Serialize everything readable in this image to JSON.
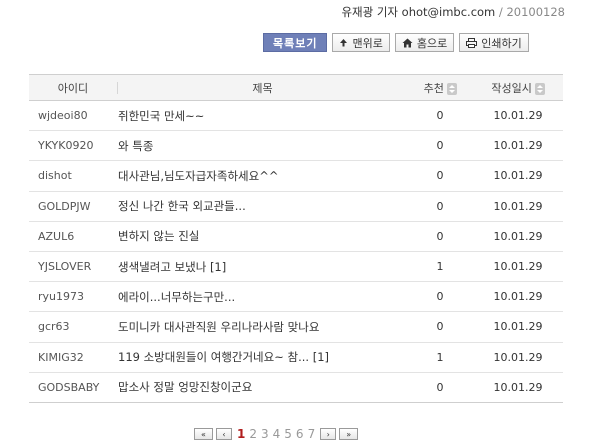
{
  "byline": {
    "author": "유재광 기자",
    "email": "ohot@imbc.com",
    "sep": " / ",
    "date": "20100128"
  },
  "toolbar": {
    "list_label": "목록보기",
    "top_label": "맨위로",
    "home_label": "홈으로",
    "print_label": "인쇄하기"
  },
  "table": {
    "headers": {
      "id": "아이디",
      "title": "제목",
      "rec": "추천",
      "date": "작성일시"
    },
    "rows": [
      {
        "id": "wjdeoi80",
        "title": "쥐한민국 만세~~",
        "rec": "0",
        "date": "10.01.29"
      },
      {
        "id": "YKYK0920",
        "title": "와 특종",
        "rec": "0",
        "date": "10.01.29"
      },
      {
        "id": "dishot",
        "title": "대사관님,님도자급자족하세요^^",
        "rec": "0",
        "date": "10.01.29"
      },
      {
        "id": "GOLDPJW",
        "title": "정신 나간 한국 외교관들...",
        "rec": "0",
        "date": "10.01.29"
      },
      {
        "id": "AZUL6",
        "title": "변하지 않는 진실",
        "rec": "0",
        "date": "10.01.29"
      },
      {
        "id": "YJSLOVER",
        "title": "생색낼려고 보냈나 [1]",
        "rec": "1",
        "date": "10.01.29"
      },
      {
        "id": "ryu1973",
        "title": "에라이...너무하는구만...",
        "rec": "0",
        "date": "10.01.29"
      },
      {
        "id": "gcr63",
        "title": "도미니카 대사관직원 우리나라사람 맞나요",
        "rec": "0",
        "date": "10.01.29"
      },
      {
        "id": "KIMIG32",
        "title": "119 소방대원들이 여행간거네요~ 참... [1]",
        "rec": "1",
        "date": "10.01.29"
      },
      {
        "id": "GODSBABY",
        "title": "맙소사 정말 엉망진창이군요",
        "rec": "0",
        "date": "10.01.29"
      }
    ]
  },
  "pager": {
    "first": "«",
    "prev": "‹",
    "pages": [
      "1",
      "2",
      "3",
      "4",
      "5",
      "6",
      "7"
    ],
    "current": "1",
    "next": "›",
    "last": "»"
  },
  "colors": {
    "primary_button": "#6f80b8",
    "active_page": "#b01d1d"
  },
  "icons": {
    "top": "arrow-up-icon",
    "home": "home-icon",
    "print": "printer-icon",
    "sort": "sort-icon"
  }
}
